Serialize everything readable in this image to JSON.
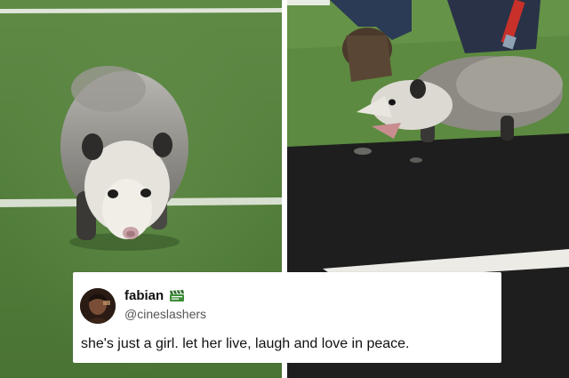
{
  "tweet": {
    "display_name": "fabian",
    "name_emoji_icon": "clapper-board-icon",
    "handle": "@cineslashers",
    "text": "she's just a girl. let her live, laugh and love in peace."
  },
  "photos": {
    "left": "opossum-running-on-football-field",
    "right": "opossum-being-pushed-off-field-with-broom"
  },
  "colors": {
    "grass": "#57823f",
    "turf_black": "#1d1d1d",
    "card_bg": "#ffffff",
    "text_primary": "#111111",
    "text_secondary": "#555555"
  }
}
